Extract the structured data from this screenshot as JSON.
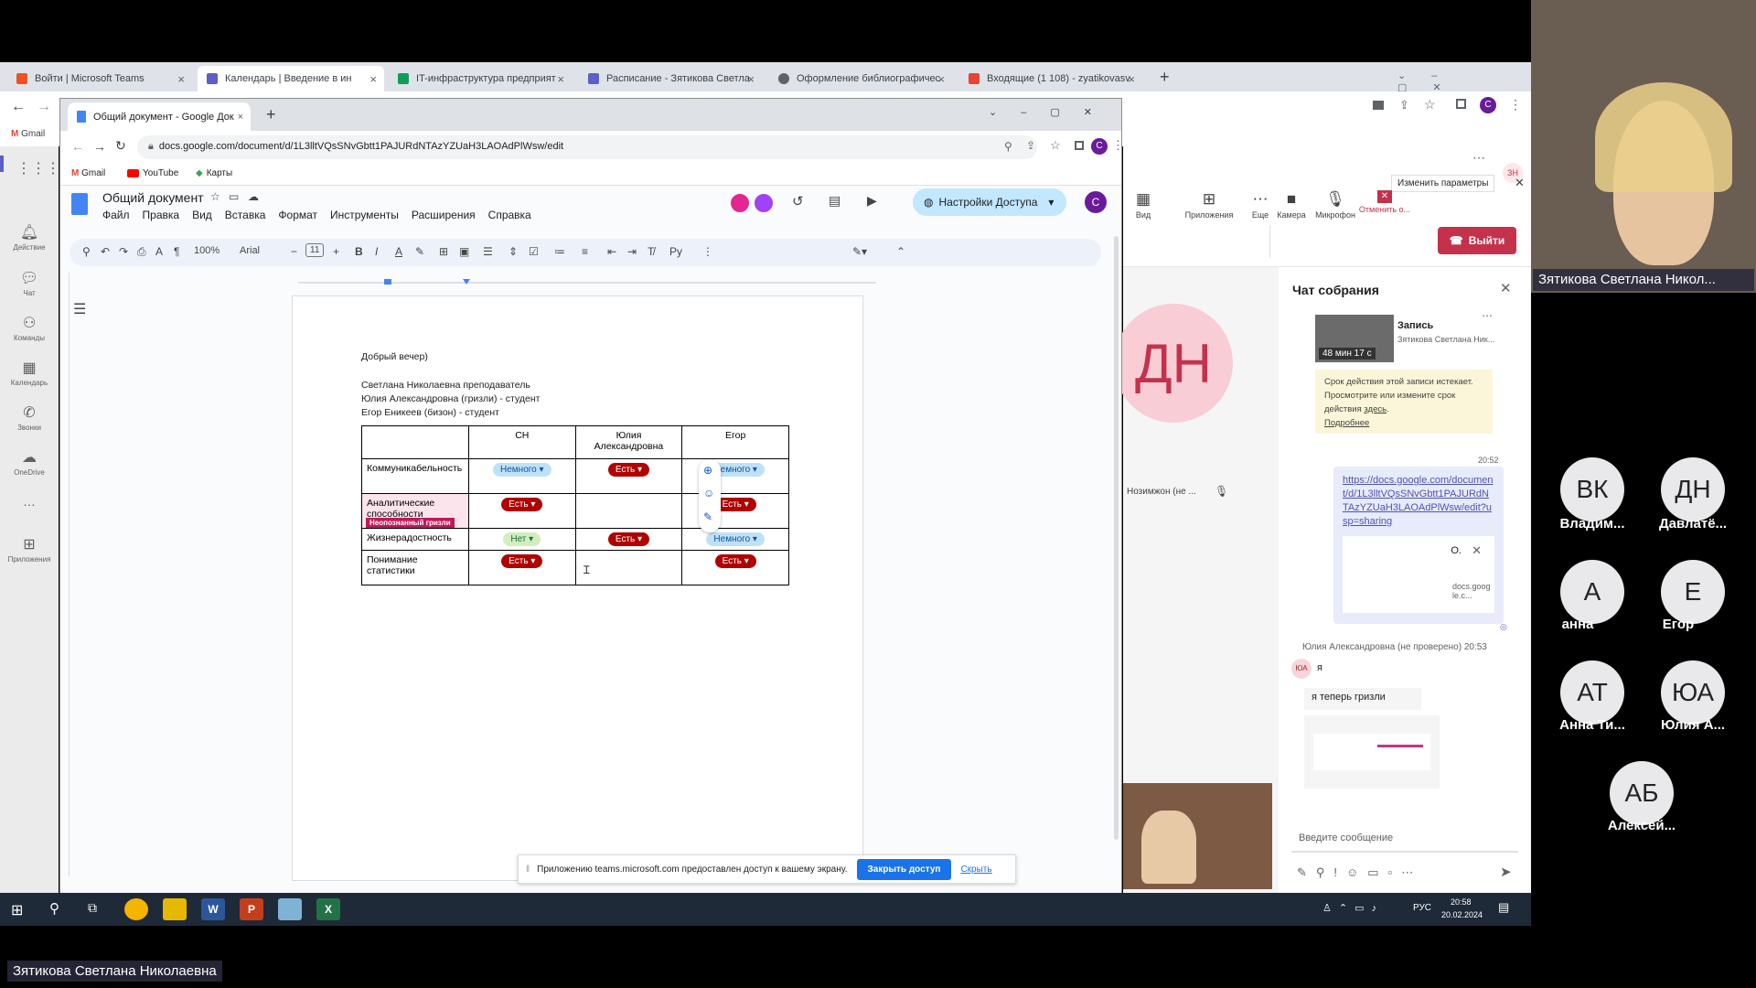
{
  "outer_tabs": [
    {
      "label": "Войти | Microsoft Teams",
      "color": "#f25022"
    },
    {
      "label": "Календарь | Введение в ин",
      "color": "#5b5fc7"
    },
    {
      "label": "IT-инфраструктура предприят",
      "color": "#0f9d58"
    },
    {
      "label": "Расписание - Зятикова Светла",
      "color": "#5b5fc7"
    },
    {
      "label": "Оформление библиографичес",
      "color": "#5f6368"
    },
    {
      "label": "Входящие (1 108) - zyatikovasv",
      "color": "#ea4335"
    }
  ],
  "outer_bookmark": "Gmail",
  "teams_rail": [
    "Действие",
    "Чат",
    "Команды",
    "Календарь",
    "Звонки",
    "OneDrive",
    "…",
    "Приложения"
  ],
  "teams_toolbar": {
    "change_params": "Изменить параметры",
    "buttons": [
      "Вид",
      "Приложения",
      "Еще",
      "Камера",
      "Микрофон",
      "Отменить о..."
    ],
    "leave": "Выйти"
  },
  "stage": {
    "avatar": "ДН",
    "name": "Нозимжон (не ..."
  },
  "chat": {
    "title": "Чат собрания",
    "recording_label": "Запись",
    "recording_author": "Зятикова Светлана Ник...",
    "recording_duration": "48 мин 17 с",
    "expire_notice": "Срок действия этой записи истекает. Просмотрите или измените срок действия",
    "expire_link": "здесь",
    "expire_more": "Подробнее",
    "time1": "20:52",
    "link": "https://docs.google.com/document/d/1L3lltVQsSNvGbtt1PAJURdNTAzYZUaH3LAOAdPlWsw/edit?usp=sharing",
    "preview_letter": "O.",
    "preview_domain": "docs.google.c...",
    "sender": "Юлия Александровна (не проверено) 20:53",
    "sender_initials": "ЮА",
    "msg1": "я",
    "msg2": "я теперь гризли",
    "input_placeholder": "Введите сообщение"
  },
  "doc": {
    "tab_title": "Общий документ - Google Док",
    "url": "docs.google.com/document/d/1L3lltVQsSNvGbtt1PAJURdNTAzYZUaH3LAOAdPlWsw/edit",
    "bookmarks": [
      "Gmail",
      "YouTube",
      "Карты"
    ],
    "title": "Общий документ",
    "menu": [
      "Файл",
      "Правка",
      "Вид",
      "Вставка",
      "Формат",
      "Инструменты",
      "Расширения",
      "Справка"
    ],
    "share_label": "Настройки Доступа",
    "account_initial": "C",
    "zoom": "100%",
    "font": "Arial",
    "font_size": "11",
    "lines": [
      "Добрый вечер)",
      "Светлана Николаевна преподаватель",
      "Юлия Александровна (гризли) - студент",
      "Егор Еникеев (бизон) - студент"
    ],
    "table_headers": [
      "",
      "СН",
      "Юлия Александровна",
      "Егор"
    ],
    "table_rows": [
      {
        "label": "Коммуникабельность",
        "cells": [
          "Немного",
          "Есть",
          "Немного"
        ],
        "styles": [
          "blue",
          "red",
          "blue"
        ]
      },
      {
        "label": "Аналитические способности",
        "cells": [
          "Есть",
          "",
          "Есть"
        ],
        "styles": [
          "red",
          "",
          "red"
        ]
      },
      {
        "label": "Жизнерадостность",
        "cells": [
          "Нет",
          "Есть",
          "Немного"
        ],
        "styles": [
          "green",
          "red",
          "blue"
        ]
      },
      {
        "label": "Понимание статистики",
        "cells": [
          "Есть",
          "",
          "Есть"
        ],
        "styles": [
          "red",
          "",
          "red"
        ]
      }
    ],
    "cursor_label": "Неопознанный гризли",
    "share_bar_text": "Приложению teams.microsoft.com предоставлен доступ к вашему экрану.",
    "share_bar_button": "Закрыть доступ",
    "share_bar_hide": "Скрыть"
  },
  "right_panel": {
    "main_name": "Зятикова Светлана Никол...",
    "participants": [
      {
        "initials": "ВК",
        "name": "Владим..."
      },
      {
        "initials": "ДН",
        "name": "Давлатё..."
      },
      {
        "initials": "А",
        "name": "анна"
      },
      {
        "initials": "Е",
        "name": "Егор"
      },
      {
        "initials": "АТ",
        "name": "Анна Ти..."
      },
      {
        "initials": "ЮА",
        "name": "Юлия А..."
      },
      {
        "initials": "АБ",
        "name": "Алексей..."
      }
    ]
  },
  "taskbar": {
    "lang": "РУС",
    "time": "20:58",
    "date": "20.02.2024"
  },
  "bottom_name": "Зятикова Светлана Николаевна"
}
